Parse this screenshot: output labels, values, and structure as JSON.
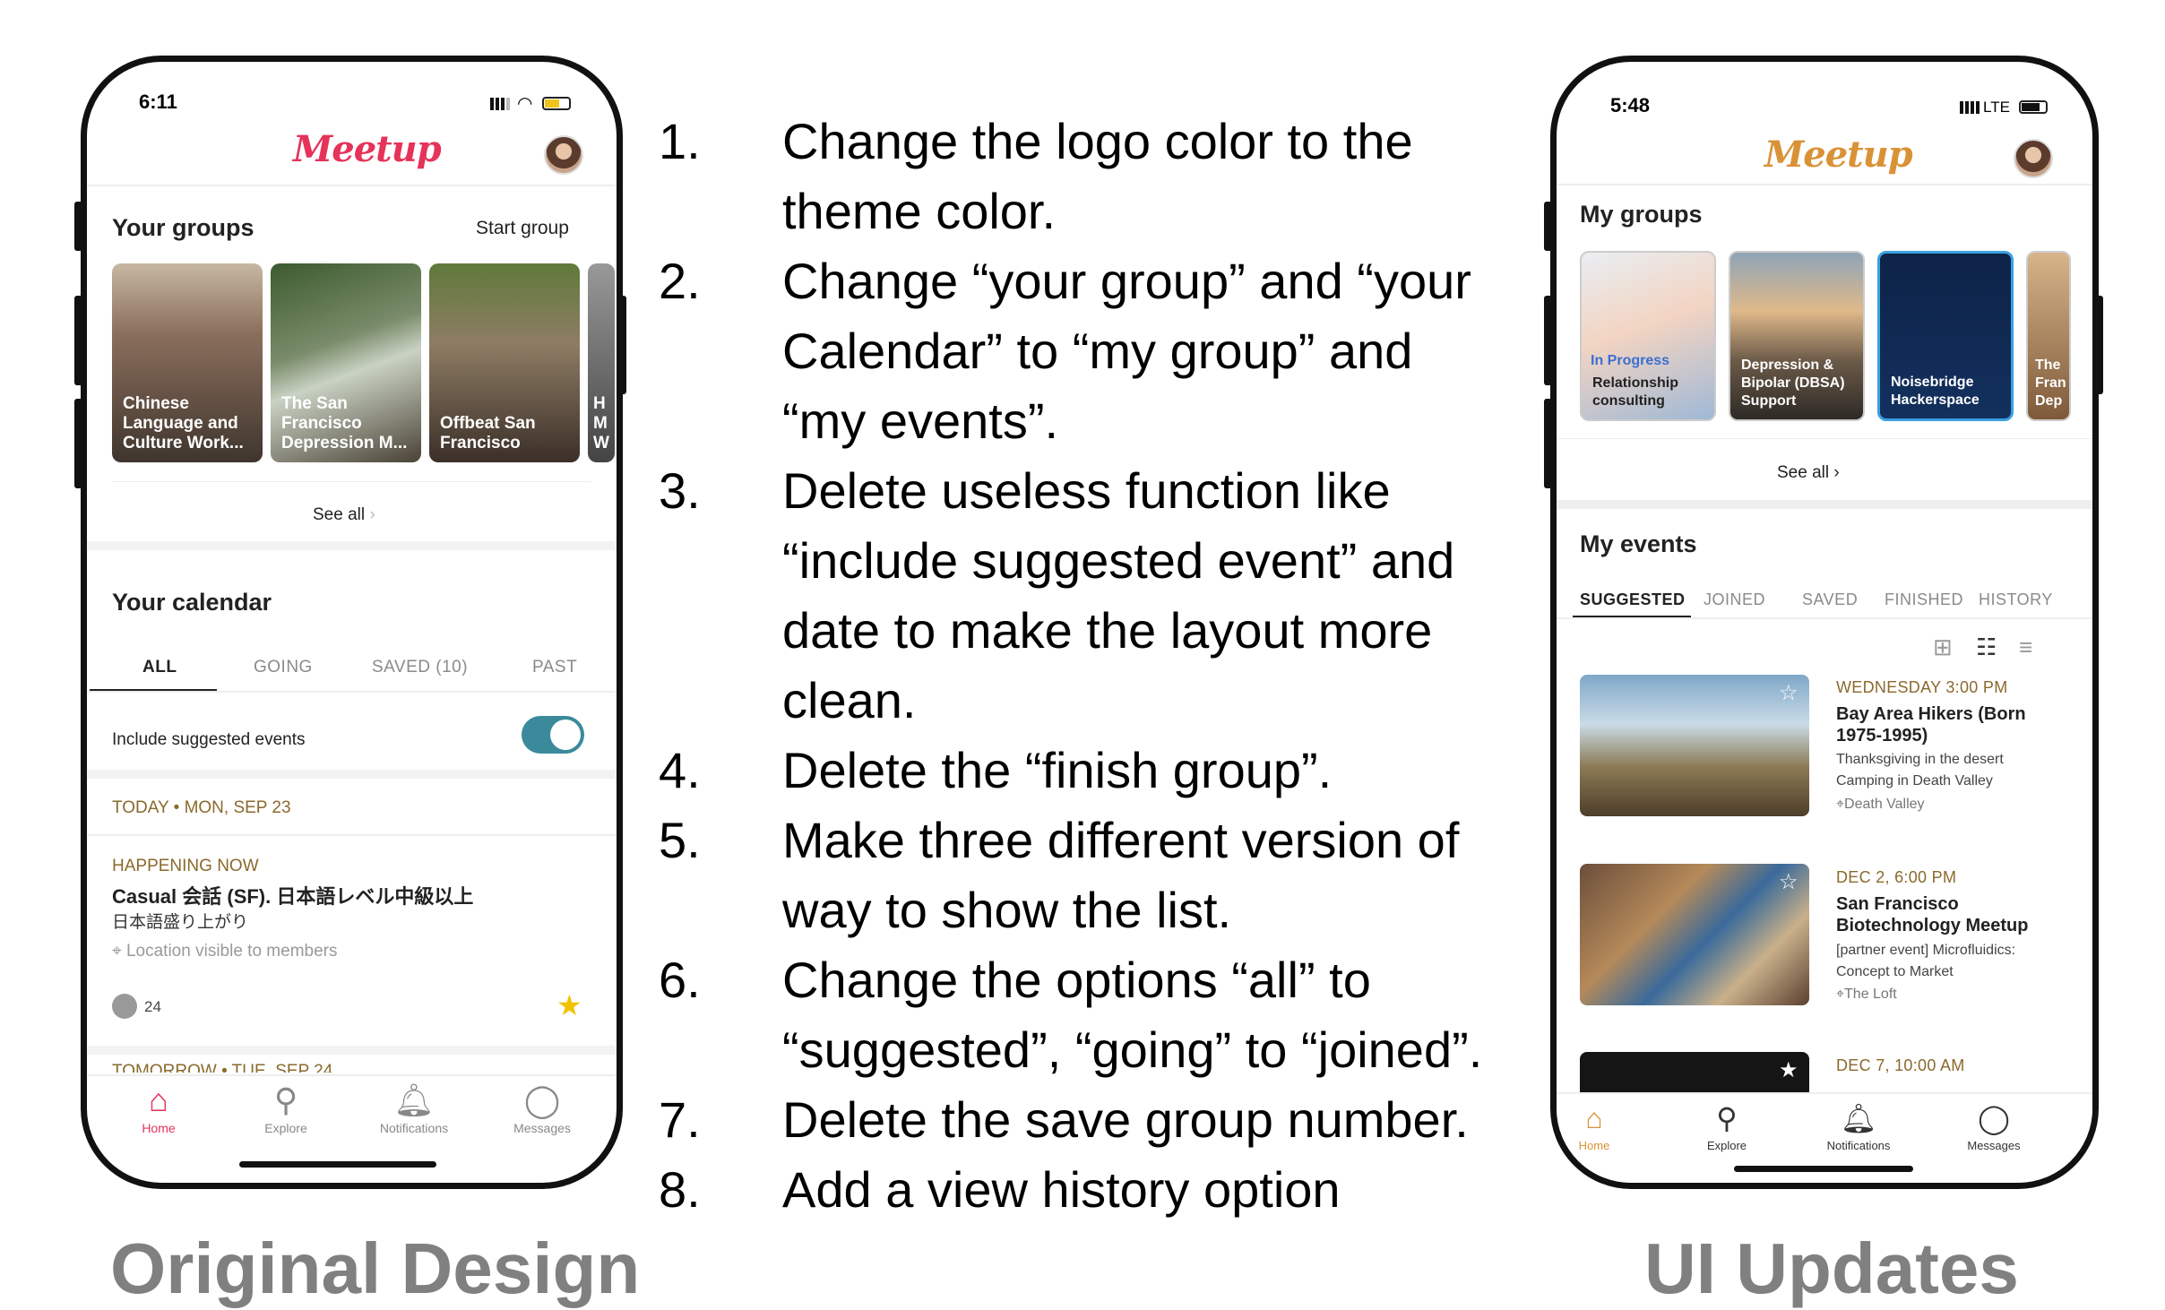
{
  "left_phone": {
    "status_time": "6:11",
    "logo": "Meetup",
    "logo_color": "#e5335a",
    "groups_title": "Your groups",
    "start_group": "Start group",
    "groups": [
      {
        "label": "Chinese\nLanguage and\nCulture Work..."
      },
      {
        "label": "The San\nFrancisco\nDepression M..."
      },
      {
        "label": "Offbeat San\nFrancisco"
      },
      {
        "label": "H\nM\nW"
      }
    ],
    "see_all": "See all",
    "calendar_title": "Your calendar",
    "tabs": [
      "ALL",
      "GOING",
      "SAVED (10)",
      "PAST"
    ],
    "include_suggested": "Include suggested events",
    "toggle_on": true,
    "accent_color": "#3b8a9c",
    "today_header": "TODAY • MON, SEP 23",
    "happening_now": "HAPPENING NOW",
    "event_title": "Casual 会話 (SF). 日本語レベル中級以上",
    "event_sub": "日本語盛り上がり",
    "event_location": "Location visible to members",
    "attendees": "24",
    "tomorrow_header": "TOMORROW • TUE, SEP 24",
    "nav": [
      {
        "label": "Home",
        "icon": "home-icon"
      },
      {
        "label": "Explore",
        "icon": "search-icon"
      },
      {
        "label": "Notifications",
        "icon": "bell-icon"
      },
      {
        "label": "Messages",
        "icon": "chat-icon"
      }
    ]
  },
  "instructions": [
    {
      "num": "1.",
      "text": "Change the logo color to the theme color."
    },
    {
      "num": "2.",
      "text": "Change “your group” and “your Calendar” to “my group” and “my events”."
    },
    {
      "num": "3.",
      "text": "Delete useless function like “include suggested event” and date to make the layout more clean."
    },
    {
      "num": "4.",
      "text": "Delete the “finish group”."
    },
    {
      "num": "5.",
      "text": "Make three different version of way to show the list."
    },
    {
      "num": "6.",
      "text": "Change the options “all” to “suggested”, “going” to “joined”."
    },
    {
      "num": "7.",
      "text": "Delete the save group number."
    },
    {
      "num": "8.",
      "text": "Add a view history option"
    }
  ],
  "right_phone": {
    "status_time": "5:48",
    "network": "LTE",
    "logo": "Meetup",
    "logo_color": "#d99236",
    "groups_title": "My groups",
    "groups": [
      {
        "label": "Relationship\nconsulting",
        "badge": "In Progress"
      },
      {
        "label": "Depression &\nBipolar (DBSA)\nSupport"
      },
      {
        "label": "Noisebridge\nHackerspace"
      },
      {
        "label": "The\nFran\nDep"
      }
    ],
    "see_all": "See all",
    "events_title": "My events",
    "tabs": [
      "SUGGESTED",
      "JOINED",
      "SAVED",
      "FINISHED",
      "HISTORY"
    ],
    "events": [
      {
        "date": "WEDNESDAY 3:00 PM",
        "title": "Bay Area Hikers (Born\n1975-1995)",
        "desc": "Thanksgiving in the desert\nCamping in Death Valley",
        "location": "Death Valley"
      },
      {
        "date": "DEC 2, 6:00 PM",
        "title": "San Francisco\nBiotechnology Meetup",
        "desc": "[partner event] Microfluidics:\nConcept to Market",
        "location": "The Loft"
      },
      {
        "date": "DEC 7, 10:00 AM"
      }
    ],
    "nav": [
      {
        "label": "Home",
        "icon": "home-icon"
      },
      {
        "label": "Explore",
        "icon": "search-icon"
      },
      {
        "label": "Notifications",
        "icon": "bell-icon"
      },
      {
        "label": "Messages",
        "icon": "chat-icon"
      }
    ],
    "theme_color": "#d99236"
  },
  "captions": {
    "left": "Original Design",
    "right": "UI Updates"
  }
}
